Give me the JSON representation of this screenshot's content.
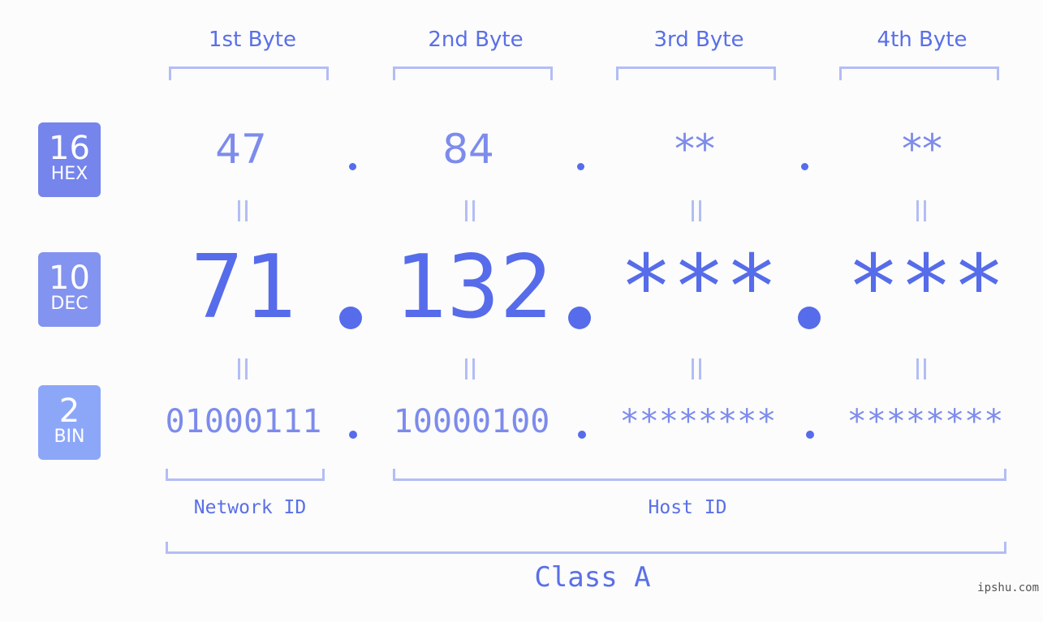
{
  "header": {
    "bytes": [
      "1st Byte",
      "2nd Byte",
      "3rd Byte",
      "4th Byte"
    ]
  },
  "badges": [
    {
      "num": "16",
      "label": "HEX",
      "color": "#7585ec"
    },
    {
      "num": "10",
      "label": "DEC",
      "color": "#8393f0"
    },
    {
      "num": "2",
      "label": "BIN",
      "color": "#8da7f8"
    }
  ],
  "rows": {
    "hex": [
      "47",
      "84",
      "**",
      "**"
    ],
    "dec": [
      "71",
      "132",
      "***",
      "***"
    ],
    "bin": [
      "01000111",
      "10000100",
      "********",
      "********"
    ]
  },
  "separator": ".",
  "equals": "=",
  "segments": {
    "network": "Network ID",
    "host": "Host ID",
    "class": "Class A"
  },
  "watermark": "ipshu.com",
  "colors": {
    "primary": "#566cea",
    "light": "#7d8bec",
    "bracket": "#b3bdf6"
  }
}
